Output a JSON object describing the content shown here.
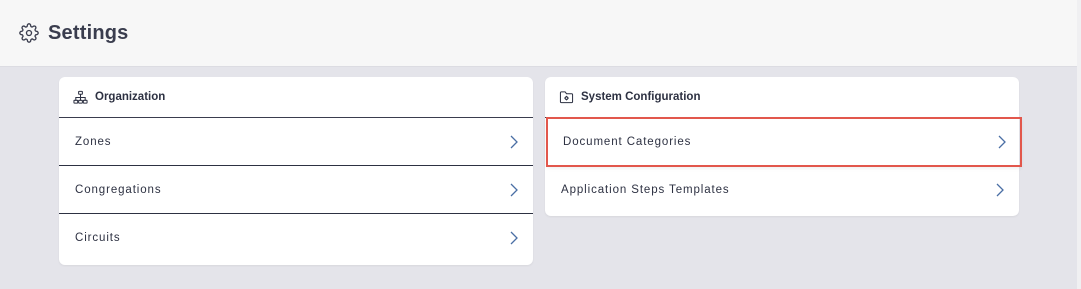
{
  "header": {
    "title": "Settings",
    "icon": "gear-icon"
  },
  "organization": {
    "title": "Organization",
    "icon": "org-chart-icon",
    "items": [
      {
        "label": "Zones"
      },
      {
        "label": "Congregations"
      },
      {
        "label": "Circuits"
      }
    ]
  },
  "system_configuration": {
    "title": "System Configuration",
    "icon": "folder-gear-icon",
    "items": [
      {
        "label": "Document Categories"
      },
      {
        "label": "Application Steps Templates"
      }
    ]
  },
  "colors": {
    "background": "#e4e4ea",
    "header_background": "#f7f7f7",
    "text": "#2d3142",
    "chevron": "#4a6fa5",
    "highlight": "#e2574c"
  }
}
